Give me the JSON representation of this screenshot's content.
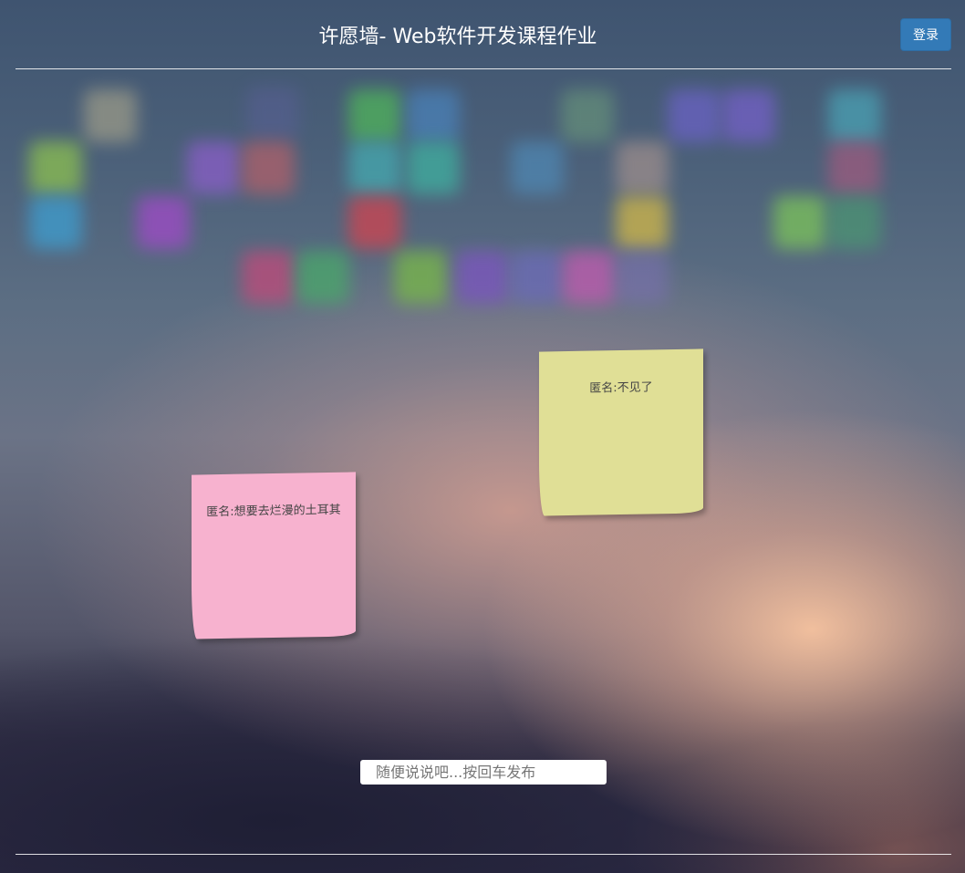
{
  "header": {
    "title": "许愿墙- Web软件开发课程作业",
    "login_label": "登录"
  },
  "notes": [
    {
      "text": "匿名:不见了",
      "color": "#e0df96"
    },
    {
      "text": "匿名:想要去烂漫的土耳其",
      "color": "#f7b2cf"
    }
  ],
  "composer": {
    "placeholder": "随便说说吧...按回车发布"
  },
  "colors": {
    "login_button": "#337ab7",
    "header_text": "#ffffff"
  }
}
